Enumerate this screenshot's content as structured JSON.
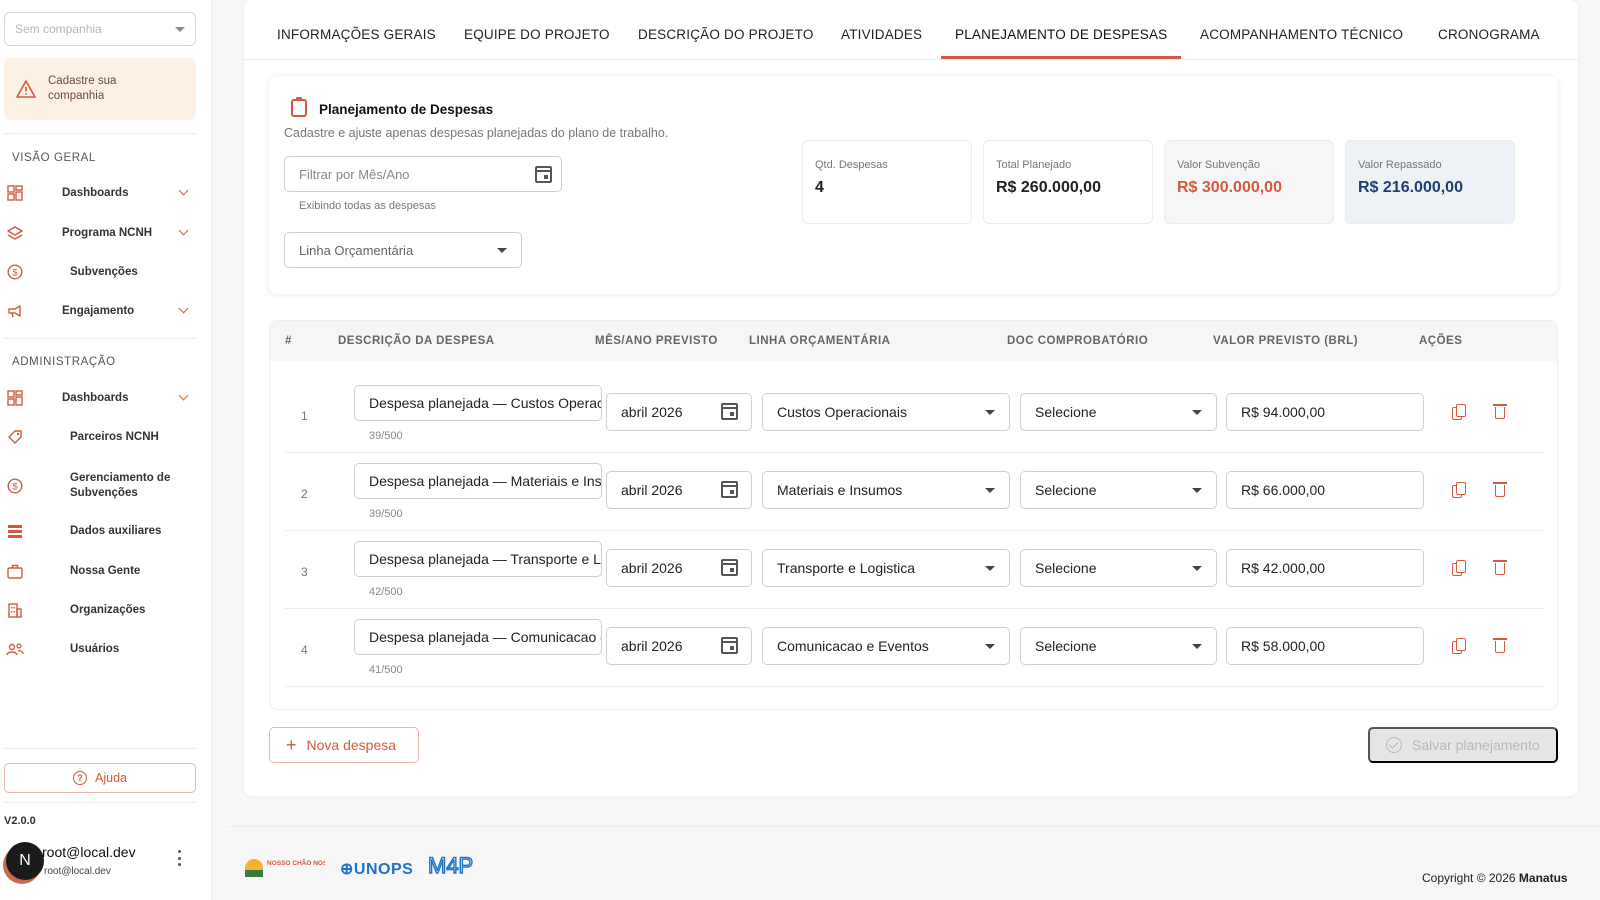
{
  "sidebar": {
    "company_placeholder": "Sem companhia",
    "warning": "Cadastre sua companhia",
    "section_overview": "VISÃO GERAL",
    "section_admin": "ADMINISTRAÇÃO",
    "overview_items": [
      {
        "label": "Dashboards",
        "icon": "dashboard-icon"
      },
      {
        "label": "Programa NCNH",
        "icon": "layers-icon"
      },
      {
        "label": "Subvenções",
        "icon": "dollar-circle-icon"
      },
      {
        "label": "Engajamento",
        "icon": "megaphone-icon"
      }
    ],
    "admin_items": [
      {
        "label": "Dashboards",
        "icon": "dashboard-icon"
      },
      {
        "label": "Parceiros NCNH",
        "icon": "tag-icon"
      },
      {
        "label": "Gerenciamento de Subvenções",
        "icon": "dollar-circle-icon"
      },
      {
        "label": "Dados auxiliares",
        "icon": "list-icon"
      },
      {
        "label": "Nossa Gente",
        "icon": "briefcase-icon"
      },
      {
        "label": "Organizações",
        "icon": "building-icon"
      },
      {
        "label": "Usuários",
        "icon": "users-icon"
      }
    ],
    "help_label": "Ajuda",
    "version": "V2.0.0",
    "user": {
      "initial": "N",
      "name": "root@local.dev",
      "email": "root@local.dev"
    }
  },
  "tabs": [
    "INFORMAÇÕES GERAIS",
    "EQUIPE DO PROJETO",
    "DESCRIÇÃO DO PROJETO",
    "ATIVIDADES",
    "PLANEJAMENTO DE DESPESAS",
    "ACOMPANHAMENTO TÉCNICO",
    "CRONOGRAMA"
  ],
  "active_tab": "PLANEJAMENTO DE DESPESAS",
  "panel": {
    "title": "Planejamento de Despesas",
    "subtitle": "Cadastre e ajuste apenas despesas planejadas do plano de trabalho.",
    "filter_placeholder": "Filtrar por Mês/Ano",
    "filter_hint": "Exibindo todas as despesas",
    "budget_line_placeholder": "Linha Orçamentária"
  },
  "stats": {
    "count": {
      "label": "Qtd. Despesas",
      "value": "4"
    },
    "total": {
      "label": "Total Planejado",
      "value": "R$ 260.000,00"
    },
    "subsidy": {
      "label": "Valor Subvenção",
      "value": "R$ 300.000,00"
    },
    "transferred": {
      "label": "Valor Repassado",
      "value": "R$ 216.000,00"
    }
  },
  "table": {
    "headers": {
      "num": "#",
      "desc": "DESCRIÇÃO DA DESPESA",
      "month": "MÊS/ANO PREVISTO",
      "line": "LINHA ORÇAMENTÁRIA",
      "doc": "DOC COMPROBATÓRIO",
      "value": "VALOR PREVISTO (BRL)",
      "actions": "AÇÕES"
    },
    "rows": [
      {
        "num": "1",
        "desc": "Despesa planejada — Custos Operacionais",
        "counter": "39/500",
        "month": "abril 2026",
        "line": "Custos Operacionais",
        "doc": "Selecione",
        "value": "R$ 94.000,00"
      },
      {
        "num": "2",
        "desc": "Despesa planejada — Materiais e Insumos",
        "counter": "39/500",
        "month": "abril 2026",
        "line": "Materiais e Insumos",
        "doc": "Selecione",
        "value": "R$ 66.000,00"
      },
      {
        "num": "3",
        "desc": "Despesa planejada — Transporte e Logistica",
        "counter": "42/500",
        "month": "abril 2026",
        "line": "Transporte e Logistica",
        "doc": "Selecione",
        "value": "R$ 42.000,00"
      },
      {
        "num": "4",
        "desc": "Despesa planejada — Comunicacao e Eventos",
        "counter": "41/500",
        "month": "abril 2026",
        "line": "Comunicacao e Eventos",
        "doc": "Selecione",
        "value": "R$ 58.000,00"
      }
    ]
  },
  "buttons": {
    "add": "Nova despesa",
    "save": "Salvar planejamento"
  },
  "footer": {
    "logo_nosso_chao": "NOSSO CHÃO NOSSA HISTÓRIA",
    "logo_unops": "UNOPS",
    "logo_m4p": "M4P",
    "copyright_prefix": "Copyright © 2026 ",
    "copyright_brand": "Manatus"
  },
  "colors": {
    "accent": "#d35a3e",
    "navy": "#1f3e73",
    "unops_blue": "#1e73c8"
  }
}
